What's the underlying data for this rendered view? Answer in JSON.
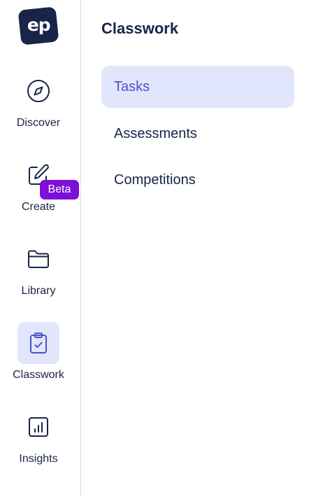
{
  "logo": {
    "text": "ep"
  },
  "nav": {
    "items": [
      {
        "label": "Discover",
        "icon": "compass-icon",
        "active": false
      },
      {
        "label": "Create",
        "icon": "edit-icon",
        "active": false,
        "badge": "Beta"
      },
      {
        "label": "Library",
        "icon": "folder-icon",
        "active": false
      },
      {
        "label": "Classwork",
        "icon": "clipboard-check-icon",
        "active": true
      },
      {
        "label": "Insights",
        "icon": "bar-chart-icon",
        "active": false
      }
    ]
  },
  "panel": {
    "title": "Classwork",
    "items": [
      {
        "label": "Tasks",
        "active": true
      },
      {
        "label": "Assessments",
        "active": false
      },
      {
        "label": "Competitions",
        "active": false
      }
    ]
  },
  "colors": {
    "navy": "#1a2449",
    "accent": "#4c52c4",
    "active_bg": "#e1e6fc",
    "badge": "#7c10d8",
    "divider": "#d9dbe3"
  }
}
